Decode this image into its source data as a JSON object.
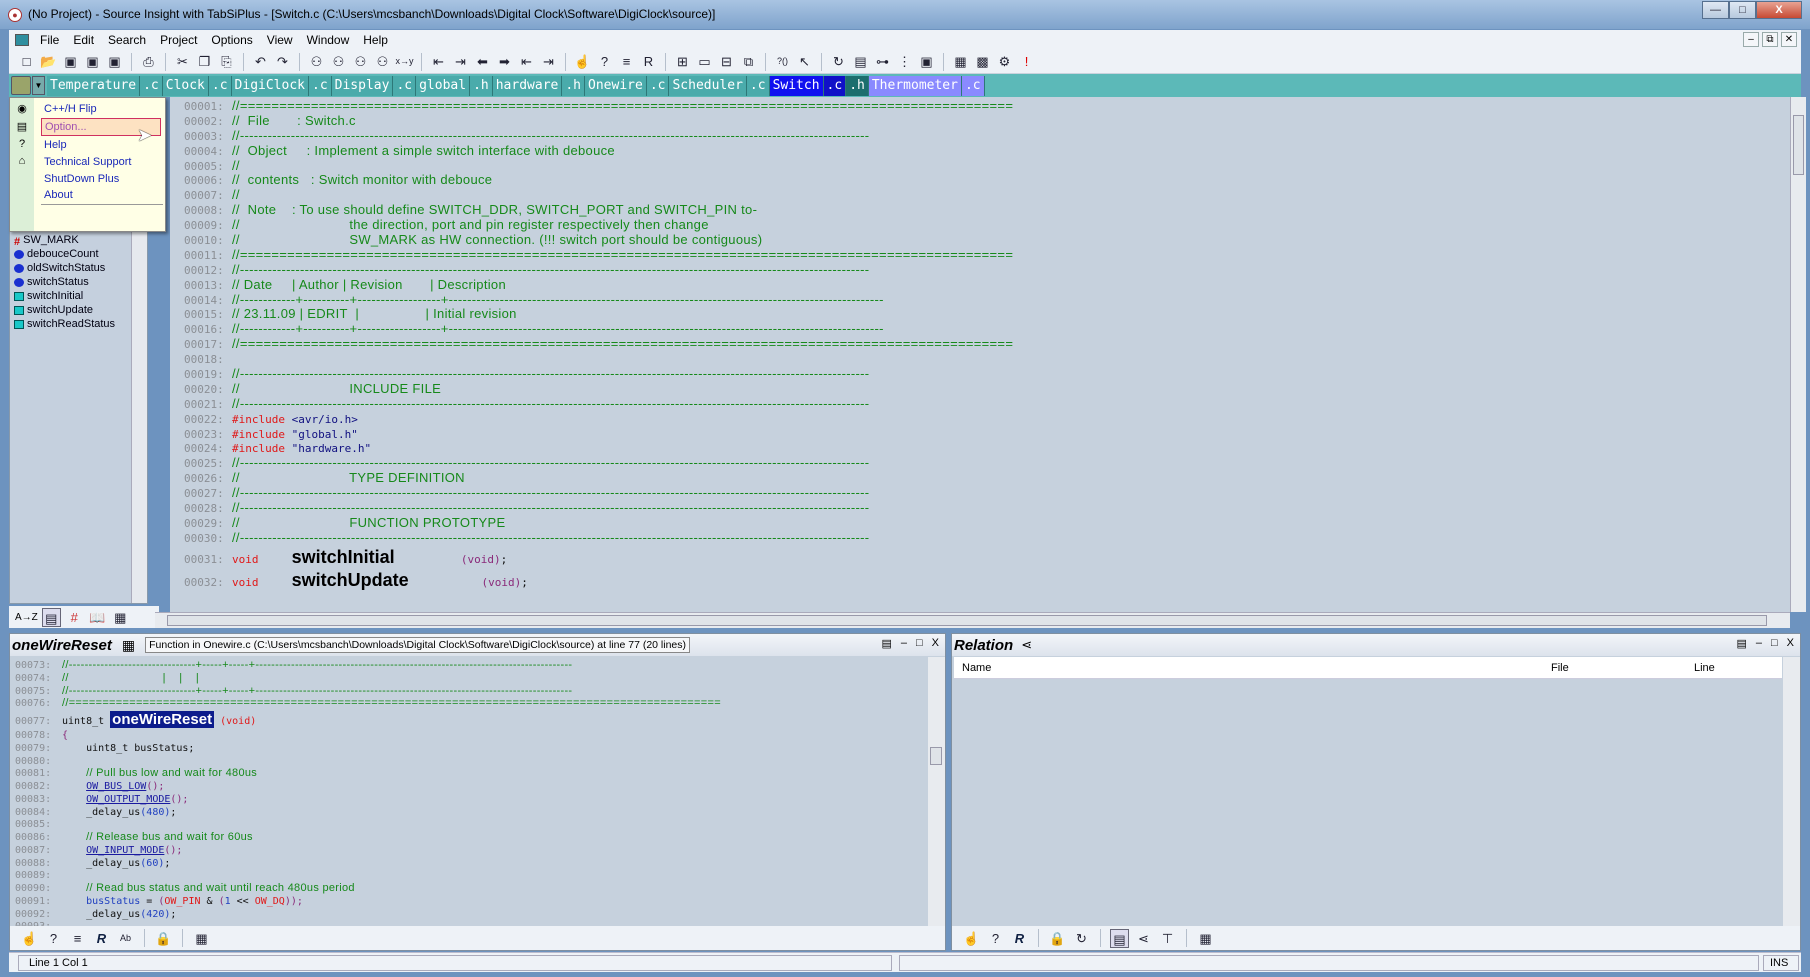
{
  "window": {
    "title": "(No Project) - Source Insight with TabSiPlus - [Switch.c (C:\\Users\\mcsbanch\\Downloads\\Digital Clock\\Software\\DigiClock\\source)]",
    "buttons": {
      "minimize": "—",
      "maximize": "□",
      "close": "X"
    }
  },
  "menubar": {
    "items": [
      "File",
      "Edit",
      "Search",
      "Project",
      "Options",
      "View",
      "Window",
      "Help"
    ],
    "mdi": {
      "minimize": "–",
      "restore": "⧉",
      "close": "✕"
    }
  },
  "toolbar": {
    "icons": [
      {
        "name": "new-file-icon",
        "glyph": "□"
      },
      {
        "name": "open-file-icon",
        "glyph": "📂"
      },
      {
        "name": "save-icon",
        "glyph": "▣"
      },
      {
        "name": "save-as-icon",
        "glyph": "▣"
      },
      {
        "name": "save-all-icon",
        "glyph": "▣"
      },
      {
        "sep": true
      },
      {
        "name": "print-icon",
        "glyph": "⎙"
      },
      {
        "sep": true
      },
      {
        "name": "cut-icon",
        "glyph": "✂"
      },
      {
        "name": "copy-icon",
        "glyph": "❐"
      },
      {
        "name": "paste-icon",
        "glyph": "⎘"
      },
      {
        "sep": true
      },
      {
        "name": "undo-icon",
        "glyph": "↶"
      },
      {
        "name": "redo-icon",
        "glyph": "↷"
      },
      {
        "sep": true
      },
      {
        "name": "search-icon",
        "glyph": "⚇"
      },
      {
        "name": "search-backward-icon",
        "glyph": "⚇"
      },
      {
        "name": "search-forward-icon",
        "glyph": "⚇"
      },
      {
        "name": "search-files-icon",
        "glyph": "⚇"
      },
      {
        "name": "replace-icon",
        "glyph": "x→y"
      },
      {
        "sep": true
      },
      {
        "name": "bookmark-prev-icon",
        "glyph": "⇤"
      },
      {
        "name": "bookmark-next-icon",
        "glyph": "⇥"
      },
      {
        "name": "back-icon",
        "glyph": "⬅"
      },
      {
        "name": "forward-icon",
        "glyph": "➡"
      },
      {
        "name": "outdent-icon",
        "glyph": "⇤"
      },
      {
        "name": "indent-icon",
        "glyph": "⇥"
      },
      {
        "sep": true
      },
      {
        "name": "jump-to-definition-icon",
        "glyph": "☝"
      },
      {
        "name": "symbol-info-icon",
        "glyph": "?"
      },
      {
        "name": "browse-icon",
        "glyph": "≡"
      },
      {
        "name": "references-icon",
        "glyph": "R"
      },
      {
        "sep": true
      },
      {
        "name": "tile-icon",
        "glyph": "⊞"
      },
      {
        "name": "window-icon",
        "glyph": "▭"
      },
      {
        "name": "split-icon",
        "glyph": "⊟"
      },
      {
        "name": "cascade-icon",
        "glyph": "⧉"
      },
      {
        "sep": true
      },
      {
        "name": "context-help-icon",
        "glyph": "?()"
      },
      {
        "name": "pointer-help-icon",
        "glyph": "↖"
      },
      {
        "sep": true
      },
      {
        "name": "sync-icon",
        "glyph": "↻"
      },
      {
        "name": "symbol-window-icon",
        "glyph": "▤"
      },
      {
        "name": "relation-window-icon",
        "glyph": "⊶"
      },
      {
        "name": "project-window-icon",
        "glyph": "⋮"
      },
      {
        "name": "context-window-icon",
        "glyph": "▣"
      },
      {
        "sep": true
      },
      {
        "name": "clip-window-icon",
        "glyph": "▦"
      },
      {
        "name": "image-icon",
        "glyph": "▩"
      },
      {
        "name": "settings-icon",
        "glyph": "⚙"
      },
      {
        "name": "alert-icon",
        "glyph": "!"
      }
    ]
  },
  "tabs": [
    {
      "name": "Temperature",
      "ext": ".c"
    },
    {
      "name": "Clock",
      "ext": ".c"
    },
    {
      "name": "DigiClock",
      "ext": ".c"
    },
    {
      "name": "Display",
      "ext": ".c"
    },
    {
      "name": "global",
      "ext": ".h"
    },
    {
      "name": "hardware",
      "ext": ".h"
    },
    {
      "name": "Onewire",
      "ext": ".c"
    },
    {
      "name": "Scheduler",
      "ext": ".c"
    },
    {
      "name": "Switch",
      "ext": ".c",
      "active": true,
      "ext2": ".h"
    },
    {
      "name": "Thermometer",
      "ext": ".c",
      "hover": true
    }
  ],
  "plugin_menu": {
    "items": [
      {
        "label": "C++/H Flip",
        "icon": "flip-icon"
      },
      {
        "label": "Option...",
        "icon": "option-icon",
        "hover": true
      },
      {
        "label": "Help",
        "icon": "help-icon"
      },
      {
        "label": "Technical Support",
        "icon": "support-icon"
      },
      {
        "label": "ShutDown Plus",
        "icon": ""
      },
      {
        "label": "About",
        "icon": ""
      }
    ]
  },
  "symbols": [
    {
      "label": "SW_MARK",
      "kind": "hash"
    },
    {
      "label": "debouceCount",
      "kind": "var"
    },
    {
      "label": "oldSwitchStatus",
      "kind": "var"
    },
    {
      "label": "switchStatus",
      "kind": "var"
    },
    {
      "label": "switchInitial",
      "kind": "fn"
    },
    {
      "label": "switchUpdate",
      "kind": "fn"
    },
    {
      "label": "switchReadStatus",
      "kind": "fn"
    }
  ],
  "symbol_toolbar": {
    "sort_label": "A→Z"
  },
  "editor": {
    "lines": [
      {
        "n": "00001",
        "s": [
          [
            "c",
            "//=================================================================================================="
          ]
        ]
      },
      {
        "n": "00002",
        "s": [
          [
            "c",
            "//  File       : Switch.c"
          ]
        ]
      },
      {
        "n": "00003",
        "s": [
          [
            "c",
            "//----------------------------------------------------------------------------------------------------------------------------------------"
          ]
        ]
      },
      {
        "n": "00004",
        "s": [
          [
            "c",
            "//  Object     : Implement a simple switch interface with debouce"
          ]
        ]
      },
      {
        "n": "00005",
        "s": [
          [
            "c",
            "//"
          ]
        ]
      },
      {
        "n": "00006",
        "s": [
          [
            "c",
            "//  contents   : Switch monitor with debouce"
          ]
        ]
      },
      {
        "n": "00007",
        "s": [
          [
            "c",
            "//"
          ]
        ]
      },
      {
        "n": "00008",
        "s": [
          [
            "c",
            "//  Note    : To use should define SWITCH_DDR, SWITCH_PORT and SWITCH_PIN to-"
          ]
        ]
      },
      {
        "n": "00009",
        "s": [
          [
            "c",
            "//                            the direction, port and pin register respectively then change"
          ]
        ]
      },
      {
        "n": "00010",
        "s": [
          [
            "c",
            "//                            SW_MARK as HW connection. (!!! switch port should be contiguous)"
          ]
        ]
      },
      {
        "n": "00011",
        "s": [
          [
            "c",
            "//=================================================================================================="
          ]
        ]
      },
      {
        "n": "00012",
        "s": [
          [
            "c",
            "//----------------------------------------------------------------------------------------------------------------------------------------"
          ]
        ]
      },
      {
        "n": "00013",
        "s": [
          [
            "c",
            "// Date     | Author | Revision       | Description"
          ]
        ]
      },
      {
        "n": "00014",
        "s": [
          [
            "c",
            "//------------+----------+------------------+----------------------------------------------------------------------------------------------"
          ]
        ]
      },
      {
        "n": "00015",
        "s": [
          [
            "c",
            "// 23.11.09 | EDRIT  |                 | Initial revision"
          ]
        ]
      },
      {
        "n": "00016",
        "s": [
          [
            "c",
            "//------------+----------+------------------+----------------------------------------------------------------------------------------------"
          ]
        ]
      },
      {
        "n": "00017",
        "s": [
          [
            "c",
            "//=================================================================================================="
          ]
        ]
      },
      {
        "n": "00018",
        "s": []
      },
      {
        "n": "00019",
        "s": [
          [
            "c",
            "//----------------------------------------------------------------------------------------------------------------------------------------"
          ]
        ]
      },
      {
        "n": "00020",
        "s": [
          [
            "c",
            "//                            INCLUDE FILE"
          ]
        ]
      },
      {
        "n": "00021",
        "s": [
          [
            "c",
            "//----------------------------------------------------------------------------------------------------------------------------------------"
          ]
        ]
      },
      {
        "n": "00022",
        "s": [
          [
            "k",
            "#include"
          ],
          [
            "s",
            " <avr/io.h>"
          ]
        ]
      },
      {
        "n": "00023",
        "s": [
          [
            "k",
            "#include"
          ],
          [
            "s",
            " \"global.h\""
          ]
        ]
      },
      {
        "n": "00024",
        "s": [
          [
            "k",
            "#include"
          ],
          [
            "s",
            " \"hardware.h\""
          ]
        ]
      },
      {
        "n": "00025",
        "s": [
          [
            "c",
            "//----------------------------------------------------------------------------------------------------------------------------------------"
          ]
        ]
      },
      {
        "n": "00026",
        "s": [
          [
            "c",
            "//                            TYPE DEFINITION"
          ]
        ]
      },
      {
        "n": "00027",
        "s": [
          [
            "c",
            "//----------------------------------------------------------------------------------------------------------------------------------------"
          ]
        ]
      },
      {
        "n": "00028",
        "s": [
          [
            "c",
            "//----------------------------------------------------------------------------------------------------------------------------------------"
          ]
        ]
      },
      {
        "n": "00029",
        "s": [
          [
            "c",
            "//                            FUNCTION PROTOTYPE"
          ]
        ]
      },
      {
        "n": "00030",
        "s": [
          [
            "c",
            "//----------------------------------------------------------------------------------------------------------------------------------------"
          ]
        ]
      },
      {
        "n": "00031",
        "big": true,
        "s": [
          [
            "k",
            "void"
          ],
          [
            "p",
            "     "
          ],
          [
            "f",
            "switchInitial"
          ],
          [
            "p",
            "          "
          ],
          [
            "v",
            "(void)"
          ],
          [
            "p",
            ";"
          ]
        ]
      },
      {
        "n": "00032",
        "big": true,
        "s": [
          [
            "k",
            "void"
          ],
          [
            "p",
            "     "
          ],
          [
            "f",
            "switchUpdate"
          ],
          [
            "p",
            "           "
          ],
          [
            "v",
            "(void)"
          ],
          [
            "p",
            ";"
          ]
        ]
      }
    ]
  },
  "context_panel": {
    "title": "oneWireReset",
    "info": "Function in Onewire.c (C:\\Users\\mcsbanch\\Downloads\\Digital Clock\\Software\\DigiClock\\source) at line 77 (20 lines)",
    "lines": [
      {
        "n": "00073",
        "s": [
          [
            "c",
            "//--------------------------------+-----+-----+--------------------------------------------------------------------------------"
          ]
        ]
      },
      {
        "n": "00074",
        "s": [
          [
            "c",
            "//                            |    |    |"
          ]
        ]
      },
      {
        "n": "00075",
        "s": [
          [
            "c",
            "//--------------------------------+-----+-----+--------------------------------------------------------------------------------"
          ]
        ]
      },
      {
        "n": "00076",
        "s": [
          [
            "c",
            "//================================================================================================="
          ]
        ]
      },
      {
        "n": "00077",
        "mid": true,
        "s": [
          [
            "p",
            "uint8_t "
          ],
          [
            "hl",
            "oneWireReset"
          ],
          [
            "p",
            " "
          ],
          [
            "k",
            "(void)"
          ]
        ]
      },
      {
        "n": "00078",
        "s": [
          [
            "v",
            "{"
          ]
        ]
      },
      {
        "n": "00079",
        "s": [
          [
            "p",
            "    uint8_t busStatus;"
          ]
        ]
      },
      {
        "n": "00080",
        "s": []
      },
      {
        "n": "00081",
        "s": [
          [
            "p",
            "    "
          ],
          [
            "c",
            "// Pull bus low and wait for 480us"
          ]
        ]
      },
      {
        "n": "00082",
        "s": [
          [
            "p",
            "    "
          ],
          [
            "m",
            "OW_BUS_LOW"
          ],
          [
            "v",
            "();"
          ]
        ]
      },
      {
        "n": "00083",
        "s": [
          [
            "p",
            "    "
          ],
          [
            "m",
            "OW_OUTPUT_MODE"
          ],
          [
            "v",
            "();"
          ]
        ]
      },
      {
        "n": "00084",
        "s": [
          [
            "p",
            "    _delay_us"
          ],
          [
            "n",
            "(480)"
          ],
          [
            "p",
            ";"
          ]
        ]
      },
      {
        "n": "00085",
        "s": []
      },
      {
        "n": "00086",
        "s": [
          [
            "p",
            "    "
          ],
          [
            "c",
            "// Release bus and wait for 60us"
          ]
        ]
      },
      {
        "n": "00087",
        "s": [
          [
            "p",
            "    "
          ],
          [
            "m",
            "OW_INPUT_MODE"
          ],
          [
            "v",
            "();"
          ]
        ]
      },
      {
        "n": "00088",
        "s": [
          [
            "p",
            "    _delay_us"
          ],
          [
            "n",
            "(60)"
          ],
          [
            "p",
            ";"
          ]
        ]
      },
      {
        "n": "00089",
        "s": []
      },
      {
        "n": "00090",
        "s": [
          [
            "p",
            "    "
          ],
          [
            "c",
            "// Read bus status and wait until reach 480us period"
          ]
        ]
      },
      {
        "n": "00091",
        "s": [
          [
            "p",
            "    "
          ],
          [
            "n",
            "busStatus"
          ],
          [
            "p",
            " = "
          ],
          [
            "v",
            "("
          ],
          [
            "k",
            "OW_PIN"
          ],
          [
            "p",
            " & "
          ],
          [
            "v",
            "("
          ],
          [
            "n",
            "1"
          ],
          [
            "p",
            " << "
          ],
          [
            "k",
            "OW_DQ"
          ],
          [
            "v",
            "));"
          ]
        ]
      },
      {
        "n": "00092",
        "s": [
          [
            "p",
            "    _delay_us"
          ],
          [
            "n",
            "(420)"
          ],
          [
            "p",
            ";"
          ]
        ]
      },
      {
        "n": "00093",
        "s": []
      }
    ]
  },
  "relation_panel": {
    "title": "Relation",
    "columns": [
      "Name",
      "File",
      "Line"
    ]
  },
  "statusbar": {
    "position": "Line 1 Col 1",
    "mode": "INS"
  },
  "colors": {
    "editor_bg": "#c6d1dd",
    "comment": "#16891a",
    "preprocessor": "#e01818",
    "tab_bar": "#5cb9b8",
    "active_tab": "#1010f0"
  }
}
